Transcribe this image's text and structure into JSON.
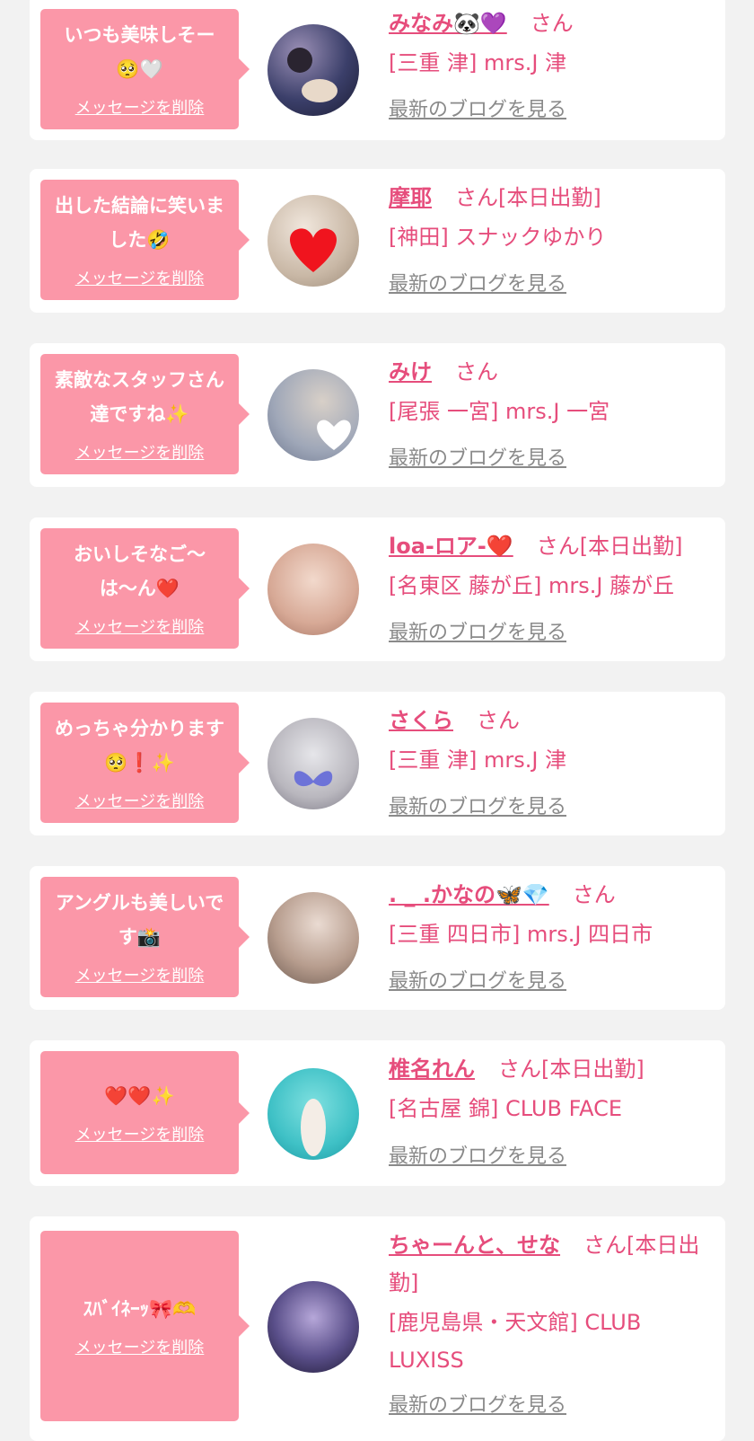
{
  "colors": {
    "background": "#f2f2f2",
    "card": "#ffffff",
    "bubble": "#fb97a8",
    "accent_text": "#e64d7c",
    "blog_link": "#8a8a8a"
  },
  "delete_label": "メッセージを削除",
  "blog_label": "最新のブログを見る",
  "items": [
    {
      "message": "いつも美味しそー🥺🤍",
      "name": "みなみ🐼💜",
      "san": "さん",
      "shop": "[三重 津] mrs.J 津"
    },
    {
      "message": "出した結論に笑いました🤣",
      "name": "摩耶",
      "san": "さん[本日出勤]",
      "shop": "[神田] スナックゆかり"
    },
    {
      "message": "素敵なスタッフさん達ですね✨",
      "name": "みけ",
      "san": "さん",
      "shop": "[尾張 一宮] mrs.J 一宮"
    },
    {
      "message": "おいしそなご〜は〜ん❤️",
      "name": "loa-ロア-❤️",
      "san": "さん[本日出勤]",
      "shop": "[名東区 藤が丘] mrs.J 藤が丘"
    },
    {
      "message": "めっちゃ分かります🥺❗️✨",
      "name": "さくら",
      "san": "さん",
      "shop": "[三重 津] mrs.J 津"
    },
    {
      "message": "アングルも美しいです📸",
      "name": ". _ .かなの🦋💎",
      "san": "さん",
      "shop": "[三重 四日市] mrs.J 四日市"
    },
    {
      "message": "❤️❤️✨",
      "name": "椎名れん",
      "san": "さん[本日出勤]",
      "shop": "[名古屋 錦] CLUB FACE"
    },
    {
      "message": "ｽﾊﾞｲﾈｰｯ🎀🫶",
      "name": "ちゃーんと、せな",
      "san": "さん[本日出勤]",
      "shop": "[鹿児島県・天文館] CLUB LUXISS"
    }
  ]
}
